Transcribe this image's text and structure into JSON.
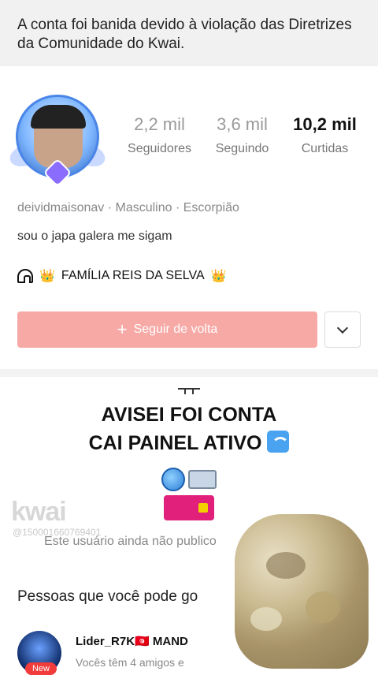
{
  "banner": {
    "text": "A conta foi banida devido à violação das Diretrizes da Comunidade do Kwai."
  },
  "profile": {
    "stats": [
      {
        "value": "2,2 mil",
        "label": "Seguidores"
      },
      {
        "value": "3,6 mil",
        "label": "Seguindo"
      },
      {
        "value": "10,2 mil",
        "label": "Curtidas"
      }
    ],
    "meta": "deividmaisonav · Masculino · Escorpião",
    "bio": "sou o japa  galera me sigam",
    "community": {
      "crown_left": "👑",
      "name": "FAMÍLIA REIS DA SELVA",
      "crown_right": "👑",
      "icon": "community-house-icon"
    },
    "follow_button": {
      "plus": "+",
      "label": "Seguir de volta"
    },
    "more_icon": "chevron-down-icon",
    "colors": {
      "follow_button_bg": "#f7a9a6"
    }
  },
  "overlay_caption": {
    "line1": "AVISEI FOI CONTA",
    "line2": "CAI PAINEL ATIVO"
  },
  "watermark": {
    "brand": "kwai",
    "id": "@150001660769401"
  },
  "empty_state": "Este usuário ainda não publico",
  "people": {
    "title": "Pessoas que você pode go",
    "items": [
      {
        "name": "Lider_R7K🇹🇳 MAND",
        "subtitle": "Vocês têm 4 amigos e",
        "badge": "New"
      }
    ]
  }
}
